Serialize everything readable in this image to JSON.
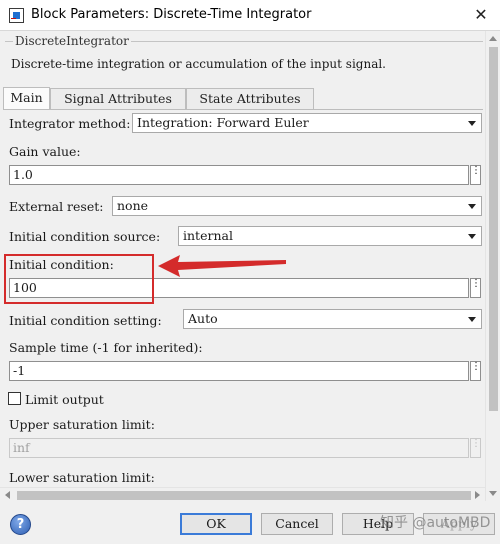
{
  "window": {
    "title": "Block Parameters: Discrete-Time Integrator",
    "close_glyph": "✕",
    "icon": "simulink-block-icon"
  },
  "description": {
    "group_title": "DiscreteIntegrator",
    "text": "Discrete-time integration or accumulation of the input signal."
  },
  "tabs": [
    {
      "label": "Main",
      "active": true
    },
    {
      "label": "Signal Attributes",
      "active": false
    },
    {
      "label": "State Attributes",
      "active": false
    }
  ],
  "main": {
    "integrator_method": {
      "label": "Integrator method:",
      "value": "Integration: Forward Euler"
    },
    "gain": {
      "label": "Gain value:",
      "value": "1.0"
    },
    "external_reset": {
      "label": "External reset:",
      "value": "none"
    },
    "ic_source": {
      "label": "Initial condition source:",
      "value": "internal"
    },
    "initial_condition": {
      "label": "Initial condition:",
      "value": "100"
    },
    "ic_setting": {
      "label": "Initial condition setting:",
      "value": "Auto"
    },
    "sample_time": {
      "label": "Sample time (-1 for inherited):",
      "value": "-1"
    },
    "limit_output": {
      "label": "Limit output",
      "checked": false
    },
    "upper_sat": {
      "label": "Upper saturation limit:",
      "value": "inf"
    },
    "lower_sat": {
      "label": "Lower saturation limit:"
    },
    "more_glyph": "⋮"
  },
  "buttons": {
    "ok": "OK",
    "cancel": "Cancel",
    "help": "Help",
    "apply": "Apply",
    "help_icon_glyph": "?"
  },
  "watermark": "知乎 @autoMBD",
  "annotation": {
    "color": "#d42b2b"
  }
}
